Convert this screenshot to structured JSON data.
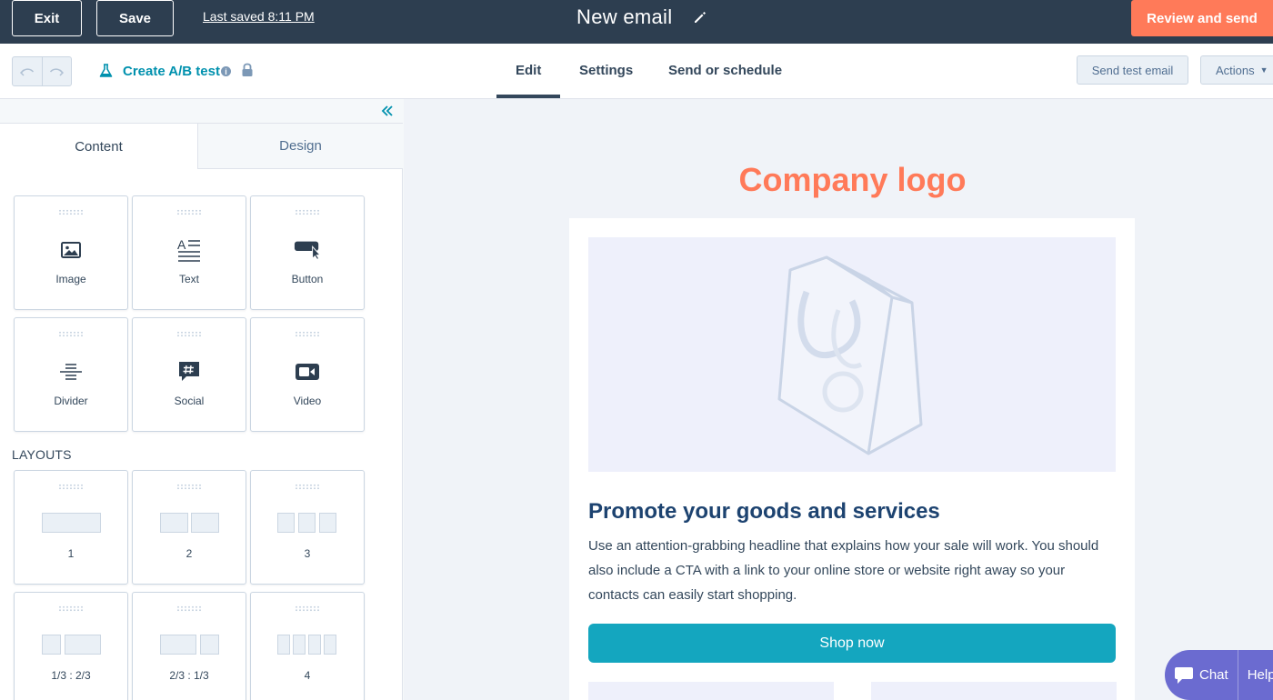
{
  "topbar": {
    "exit_label": "Exit",
    "save_label": "Save",
    "last_saved": "Last saved 8:11 PM",
    "title": "New email",
    "review_label": "Review and send"
  },
  "subbar": {
    "ab_test_label": "Create A/B test",
    "info_glyph": "i",
    "tabs": [
      {
        "label": "Edit",
        "active": true
      },
      {
        "label": "Settings",
        "active": false
      },
      {
        "label": "Send or schedule",
        "active": false
      }
    ],
    "send_test_label": "Send test email",
    "actions_label": "Actions"
  },
  "panel": {
    "tabs": [
      {
        "label": "Content",
        "active": true
      },
      {
        "label": "Design",
        "active": false
      }
    ],
    "modules": [
      {
        "label": "Image",
        "icon": "image-icon"
      },
      {
        "label": "Text",
        "icon": "text-icon"
      },
      {
        "label": "Button",
        "icon": "button-icon"
      },
      {
        "label": "Divider",
        "icon": "divider-icon"
      },
      {
        "label": "Social",
        "icon": "social-icon"
      },
      {
        "label": "Video",
        "icon": "video-icon"
      }
    ],
    "layouts_heading": "LAYOUTS",
    "layouts": [
      {
        "label": "1"
      },
      {
        "label": "2"
      },
      {
        "label": "3"
      },
      {
        "label": "1/3 : 2/3"
      },
      {
        "label": "2/3 : 1/3"
      },
      {
        "label": "4"
      }
    ]
  },
  "email": {
    "logo_text": "Company logo",
    "headline": "Promote your goods and services",
    "body": "Use an attention-grabbing headline that explains how your sale will work. You should also include a CTA with a link to your online store or website right away so your contacts can easily start shopping.",
    "cta_label": "Shop now"
  },
  "chat_widget": {
    "chat_label": "Chat",
    "help_label": "Help"
  },
  "colors": {
    "topbar": "#2d3e50",
    "accent_orange": "#ff7a59",
    "link_teal": "#0091ae",
    "cta_teal": "#14a6bf",
    "headline_navy": "#1d4370",
    "chat_purple": "#6b6bd0"
  }
}
